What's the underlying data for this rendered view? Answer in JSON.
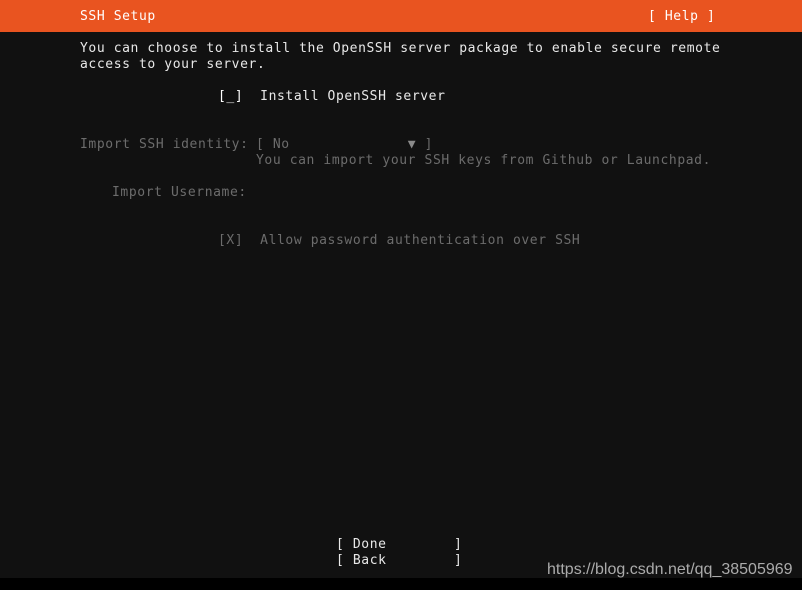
{
  "header": {
    "title": "SSH Setup",
    "help_label": "[ Help ]",
    "bar_color": "#e95420"
  },
  "colors": {
    "background": "#111111",
    "accent_orange": "#e95420",
    "text_bright": "#e8e8e8",
    "text_dim": "#6c6c6c",
    "footer_black": "#000000"
  },
  "main": {
    "intro_line_1": "You can choose to install the OpenSSH server package to enable secure remote",
    "intro_line_2": "access to your server.",
    "install_ssh": {
      "checkbox": "[_]",
      "label": "Install OpenSSH server",
      "checked": false,
      "focused": true
    },
    "import_identity": {
      "label": "Import SSH identity:",
      "bracket_open": "[",
      "value": "No",
      "arrow": "▼",
      "bracket_close": "]",
      "hint": "You can import your SSH keys from Github or Launchpad.",
      "disabled": true
    },
    "import_username": {
      "label": "Import Username:",
      "value": "",
      "disabled": true
    },
    "allow_password_auth": {
      "checkbox": "[X]",
      "label": "Allow password authentication over SSH",
      "checked": true,
      "disabled": true
    }
  },
  "buttons": {
    "done": "[ Done        ]",
    "back": "[ Back        ]"
  },
  "watermark": {
    "text": "https://blog.csdn.net/qq_38505969"
  }
}
